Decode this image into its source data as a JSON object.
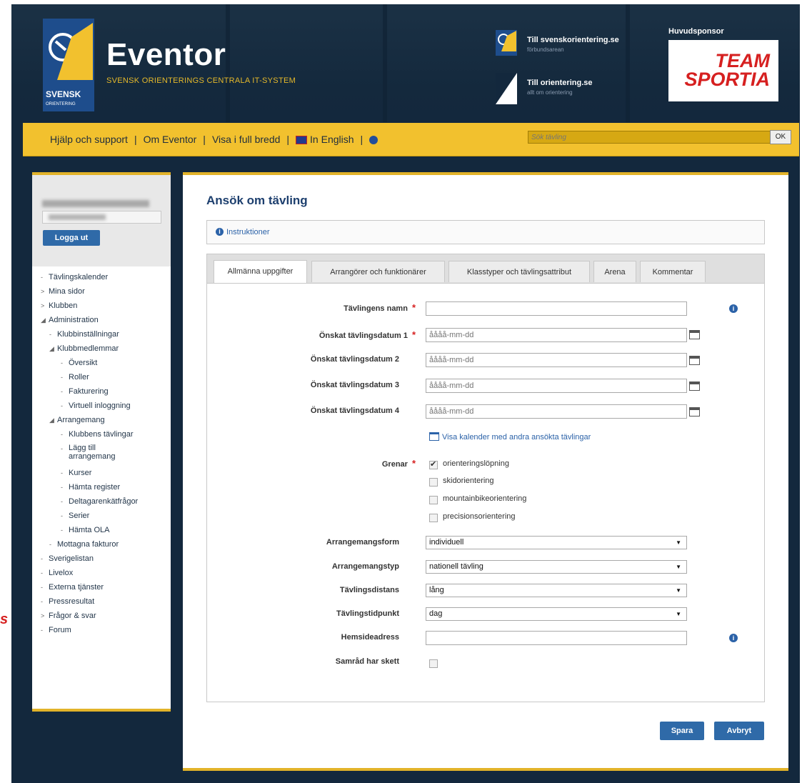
{
  "header": {
    "logo_brand": "SVENSK",
    "logo_brand_sub": "ORIENTERING",
    "site_title": "Eventor",
    "site_subtitle": "SVENSK ORIENTERINGS CENTRALA IT-SYSTEM",
    "links": [
      {
        "title": "Till svenskorientering.se",
        "sub": "förbundsarean"
      },
      {
        "title": "Till orientering.se",
        "sub": "allt om orientering"
      }
    ],
    "sponsor_label": "Huvudsponsor",
    "sponsor_line1": "TEAM",
    "sponsor_line2": "SPORTIA"
  },
  "nav": {
    "help": "Hjälp och support",
    "about": "Om Eventor",
    "fullwidth": "Visa i full bredd",
    "english": "In English",
    "search_placeholder": "Sök tävling",
    "search_button": "OK"
  },
  "sidebar": {
    "logout": "Logga ut",
    "menu": [
      {
        "label": "Tävlingskalender",
        "marker": "-",
        "level": 0
      },
      {
        "label": "Mina sidor",
        "marker": ">",
        "level": 0
      },
      {
        "label": "Klubben",
        "marker": ">",
        "level": 0
      },
      {
        "label": "Administration",
        "marker": "◢",
        "level": 0
      },
      {
        "label": "Klubbinställningar",
        "marker": "-",
        "level": 1
      },
      {
        "label": "Klubbmedlemmar",
        "marker": "◢",
        "level": 1
      },
      {
        "label": "Översikt",
        "marker": "-",
        "level": 2
      },
      {
        "label": "Roller",
        "marker": "-",
        "level": 2
      },
      {
        "label": "Fakturering",
        "marker": "-",
        "level": 2
      },
      {
        "label": "Virtuell inloggning",
        "marker": "-",
        "level": 2
      },
      {
        "label": "Arrangemang",
        "marker": "◢",
        "level": 1
      },
      {
        "label": "Klubbens tävlingar",
        "marker": "-",
        "level": 2
      },
      {
        "label": "Lägg till arrangemang",
        "marker": "-",
        "level": 2
      },
      {
        "label": "Kurser",
        "marker": "-",
        "level": 2
      },
      {
        "label": "Hämta register",
        "marker": "-",
        "level": 2
      },
      {
        "label": "Deltagarenkätfrågor",
        "marker": "-",
        "level": 2
      },
      {
        "label": "Serier",
        "marker": "-",
        "level": 2
      },
      {
        "label": "Hämta OLA",
        "marker": "-",
        "level": 2
      },
      {
        "label": "Mottagna fakturor",
        "marker": "-",
        "level": 1
      },
      {
        "label": "Sverigelistan",
        "marker": "-",
        "level": 0
      },
      {
        "label": "Livelox",
        "marker": "-",
        "level": 0
      },
      {
        "label": "Externa tjänster",
        "marker": "-",
        "level": 0
      },
      {
        "label": "Pressresultat",
        "marker": "-",
        "level": 0
      },
      {
        "label": "Frågor & svar",
        "marker": ">",
        "level": 0
      },
      {
        "label": "Forum",
        "marker": "-",
        "level": 0
      }
    ]
  },
  "main": {
    "title": "Ansök om tävling",
    "instructions": "Instruktioner",
    "tabs": [
      "Allmänna uppgifter",
      "Arrangörer och funktionärer",
      "Klasstyper och tävlingsattribut",
      "Arena",
      "Kommentar"
    ],
    "form": {
      "name_label": "Tävlingens namn",
      "name_value": "",
      "date_labels": [
        "Önskat tävlingsdatum 1",
        "Önskat tävlingsdatum 2",
        "Önskat tävlingsdatum 3",
        "Önskat tävlingsdatum 4"
      ],
      "date_placeholder": "åååå-mm-dd",
      "calendar_link": "Visa kalender med andra ansökta tävlingar",
      "branch_label": "Grenar",
      "branches": [
        {
          "label": "orienteringslöpning",
          "checked": true
        },
        {
          "label": "skidorientering",
          "checked": false
        },
        {
          "label": "mountainbikeorientering",
          "checked": false
        },
        {
          "label": "precisionsorientering",
          "checked": false
        }
      ],
      "form_label": "Arrangemangsform",
      "form_value": "individuell",
      "type_label": "Arrangemangstyp",
      "type_value": "nationell tävling",
      "distance_label": "Tävlingsdistans",
      "distance_value": "lång",
      "time_label": "Tävlingstidpunkt",
      "time_value": "dag",
      "website_label": "Hemsideadress",
      "website_value": "",
      "consult_label": "Samråd har skett"
    },
    "save": "Spara",
    "cancel": "Avbryt"
  },
  "artifact_text": "s",
  "colors": {
    "background": "#13283d",
    "navbar": "#f2c12e",
    "accent_blue": "#2f6aa8",
    "title_blue": "#1d3f6e",
    "required_red": "#d62020"
  }
}
